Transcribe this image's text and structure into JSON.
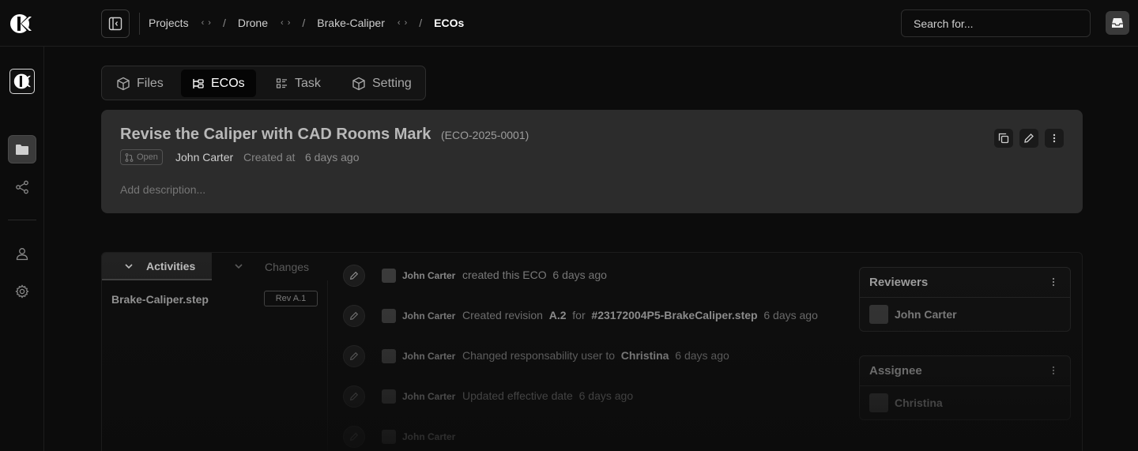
{
  "breadcrumbs": [
    {
      "label": "Projects"
    },
    {
      "label": "Drone"
    },
    {
      "label": "Brake-Caliper"
    },
    {
      "label": "ECOs"
    }
  ],
  "search": {
    "placeholder": "Search for..."
  },
  "tabs": [
    {
      "label": "Files",
      "icon": "cube-icon"
    },
    {
      "label": "ECOs",
      "icon": "tree-icon",
      "active": true
    },
    {
      "label": "Task",
      "icon": "tasklist-icon"
    },
    {
      "label": "Setting",
      "icon": "settings-cube-icon"
    }
  ],
  "eco": {
    "title": "Revise the Caliper with CAD Rooms Mark",
    "id": "(ECO-2025-0001)",
    "status": "Open",
    "author": "John Carter",
    "created_label": "Created at",
    "created_value": "6 days ago",
    "description_placeholder": "Add description..."
  },
  "panel": {
    "tabs": [
      {
        "label": "Activities",
        "active": true
      },
      {
        "label": "Changes"
      }
    ],
    "files": [
      {
        "name": "Brake-Caliper.step",
        "revision": "Rev A.1"
      }
    ]
  },
  "activities": [
    {
      "user": "John Carter",
      "pre": "created this ECO",
      "time": "6 days ago"
    },
    {
      "user": "John Carter",
      "pre": "Created revision",
      "b1": "A.2",
      "mid": "for",
      "b2": "#23172004P5-BrakeCaliper.step",
      "time": "6 days ago"
    },
    {
      "user": "John Carter",
      "pre": "Changed responsability user to",
      "b1": "Christina",
      "time": "6 days ago"
    },
    {
      "user": "John Carter",
      "pre": "Updated effective date",
      "time": "6 days ago"
    },
    {
      "user": "John Carter",
      "pre": "",
      "time": ""
    }
  ],
  "reviewers": {
    "title": "Reviewers",
    "users": [
      "John Carter"
    ]
  },
  "assignee": {
    "title": "Assignee",
    "users": [
      "Christina"
    ]
  },
  "colors": {
    "background": "#0c0c0c",
    "card": "#2c2c2c",
    "accent_active": "#ffffff"
  }
}
